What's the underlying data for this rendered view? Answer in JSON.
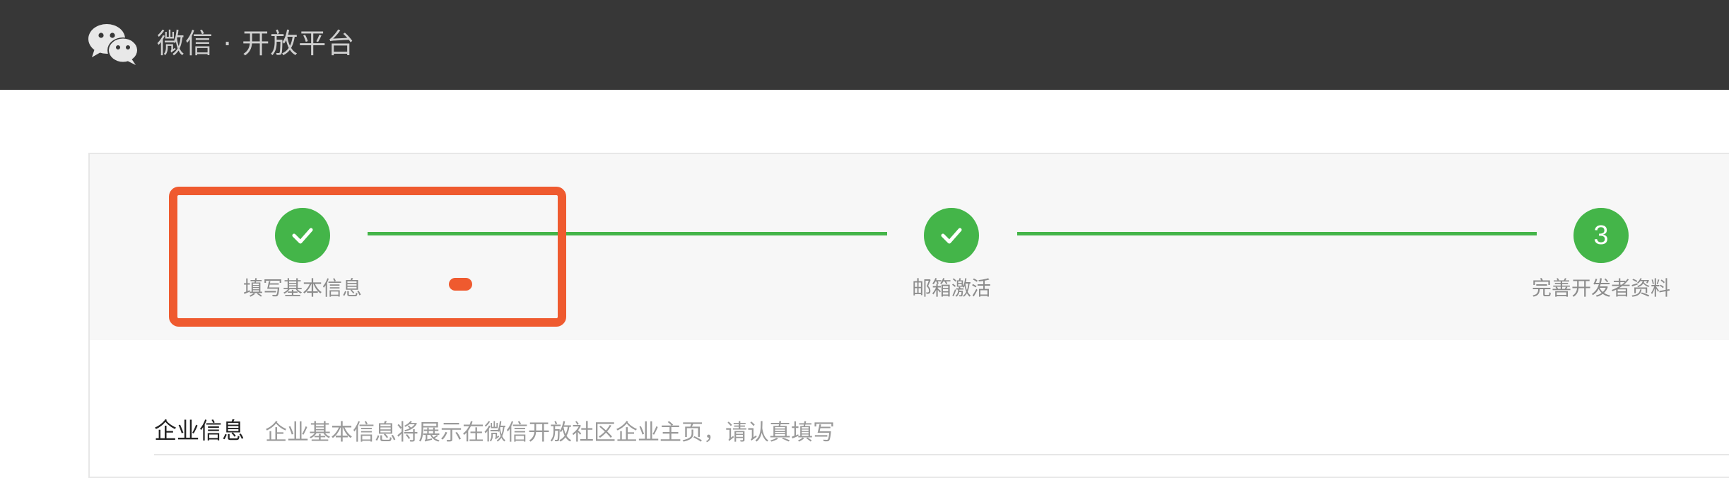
{
  "header": {
    "brand": "微信 · 开放平台",
    "logo_icon": "wechat-icon"
  },
  "steps": [
    {
      "label": "填写基本信息",
      "state": "done",
      "icon": "check-icon"
    },
    {
      "label": "邮箱激活",
      "state": "done",
      "icon": "check-icon"
    },
    {
      "label": "完善开发者资料",
      "state": "current",
      "number": "3"
    }
  ],
  "section": {
    "title": "企业信息",
    "description": "企业基本信息将展示在微信开放社区企业主页，请认真填写"
  },
  "colors": {
    "topbar": "#373737",
    "accent_green": "#44b549",
    "highlight": "#ef5a2f"
  }
}
